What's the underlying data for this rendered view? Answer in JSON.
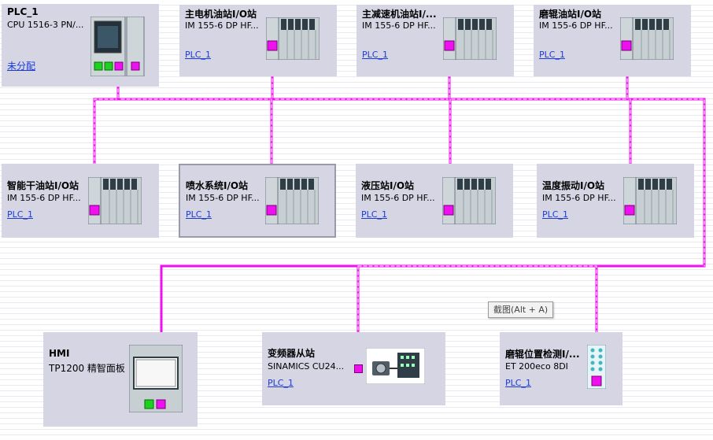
{
  "colors": {
    "profibus": "#ee10ee",
    "link": "#1a3bd6",
    "card": "#d6d5e4",
    "hmi_port": "#20d020"
  },
  "devices": {
    "plc": {
      "name": "PLC_1",
      "type": "CPU 1516-3 PN/...",
      "link": "未分配"
    },
    "io1": {
      "name": "主电机油站I/O站",
      "type": "IM 155-6 DP HF...",
      "link": "PLC_1"
    },
    "io2": {
      "name": "主减速机油站I/...",
      "type": "IM 155-6 DP HF...",
      "link": "PLC_1"
    },
    "io3": {
      "name": "磨辊油站I/O站",
      "type": "IM 155-6 DP HF...",
      "link": "PLC_1"
    },
    "io4": {
      "name": "智能干油站I/O站",
      "type": "IM 155-6 DP HF...",
      "link": "PLC_1"
    },
    "io5": {
      "name": "喷水系统I/O站",
      "type": "IM 155-6 DP HF...",
      "link": "PLC_1"
    },
    "io6": {
      "name": "液压站I/O站",
      "type": "IM 155-6 DP HF...",
      "link": "PLC_1"
    },
    "io7": {
      "name": "温度振动I/O站",
      "type": "IM 155-6 DP HF...",
      "link": "PLC_1"
    },
    "hmi": {
      "name": "HMI",
      "type": "TP1200 精智面板"
    },
    "vfd": {
      "name": "变频器从站",
      "type": "SINAMICS  CU24...",
      "link": "PLC_1"
    },
    "et": {
      "name": "磨辊位置检测I/...",
      "type": "ET 200eco 8DI",
      "link": "PLC_1"
    }
  },
  "tooltip": "截图(Alt + A)"
}
